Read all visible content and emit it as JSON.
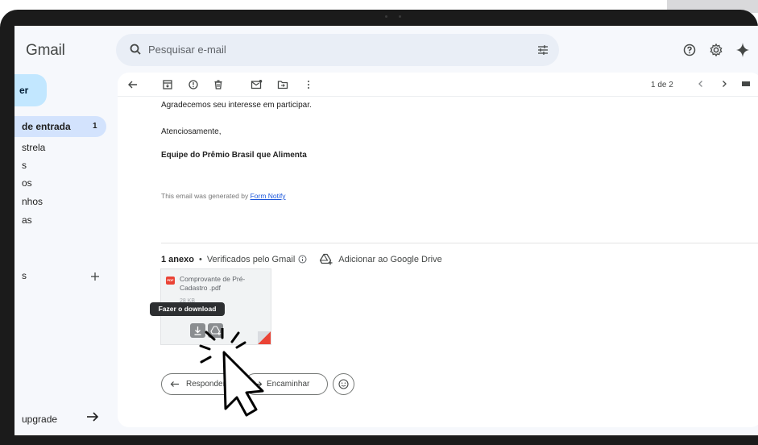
{
  "app": {
    "logo_text": "Gmail"
  },
  "search": {
    "placeholder": "Pesquisar e-mail"
  },
  "nav": {
    "compose_label": "er",
    "items": [
      {
        "label": "de entrada",
        "count": "1"
      },
      {
        "label": "strela"
      },
      {
        "label": "s"
      },
      {
        "label": "os"
      },
      {
        "label": "nhos"
      },
      {
        "label": "as"
      }
    ],
    "labels_title": "s",
    "upgrade_label": "upgrade"
  },
  "toolbar": {
    "page_count": "1 de 2"
  },
  "message": {
    "line1": "Agradecemos seu interesse em participar.",
    "line2": "Atenciosamente,",
    "signature": "Equipe do Prêmio Brasil que Alimenta",
    "generated_prefix": "This email was generated by ",
    "generated_link": "Form Notify"
  },
  "attachments": {
    "count_label": "1 anexo",
    "verified_label": "Verificados pelo Gmail",
    "add_drive_label": "Adicionar ao Google Drive",
    "file": {
      "name": "Comprovante de Pré-Cadastro .pdf",
      "size": "28 KB",
      "type_badge": "PDF"
    },
    "tooltip": "Fazer o download"
  },
  "actions": {
    "reply_label": "Responder",
    "forward_label": "Encaminhar"
  },
  "colors": {
    "compose_bg": "#c2e7ff",
    "inbox_active_bg": "#d3e3fd",
    "pdf_red": "#ea4335",
    "link_blue": "#1a56db"
  },
  "icons": [
    "search-icon",
    "filter-icon",
    "help-icon",
    "gear-icon",
    "sparkle-icon",
    "back-arrow-icon",
    "archive-icon",
    "report-spam-icon",
    "delete-icon",
    "mark-unread-icon",
    "move-to-icon",
    "more-vert-icon",
    "chevron-left-icon",
    "chevron-right-icon",
    "plus-icon",
    "arrow-right-icon",
    "info-icon",
    "add-to-drive-icon",
    "download-icon",
    "reply-icon",
    "forward-icon",
    "emoji-icon",
    "click-cursor-icon"
  ]
}
